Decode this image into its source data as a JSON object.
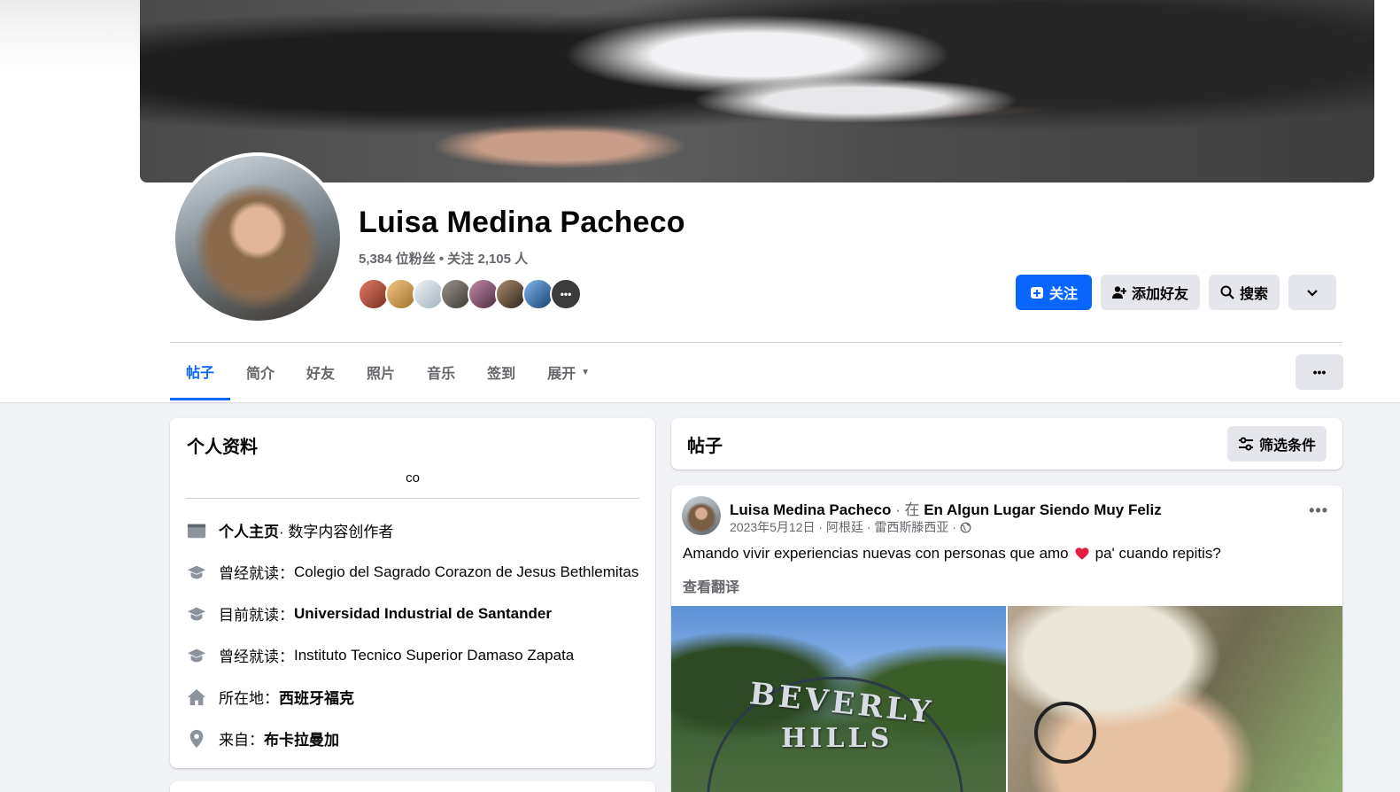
{
  "profile": {
    "name": "Luisa Medina Pacheco",
    "followers_text": "5,384 位粉丝 • 关注 2,105 人",
    "friend_avatar_colors": [
      "#b85a4c",
      "#d9a85c",
      "#c9d6de",
      "#6f6a64",
      "#8a5f78",
      "#5a4a3a",
      "#2f6fb8"
    ],
    "more_friends_label": "•••"
  },
  "actions": {
    "follow_label": "关注",
    "add_friend_label": "添加好友",
    "search_label": "搜索"
  },
  "tabs": [
    {
      "label": "帖子",
      "active": true
    },
    {
      "label": "简介"
    },
    {
      "label": "好友"
    },
    {
      "label": "照片"
    },
    {
      "label": "音乐"
    },
    {
      "label": "签到"
    },
    {
      "label": "展开"
    }
  ],
  "tabs_more_label": "•••",
  "intro": {
    "title": "个人资料",
    "bio": "co",
    "page_bold": "个人主页",
    "page_rest": " · 数字内容创作者",
    "edu1_label": "曾经就读：",
    "edu1_value": "Colegio del Sagrado Corazon de Jesus Bethlemitas",
    "edu2_label": "目前就读：",
    "edu2_value": "Universidad Industrial de Santander",
    "edu3_label": "曾经就读：",
    "edu3_value": "Instituto Tecnico Superior Damaso Zapata",
    "lives_label": "所在地：",
    "lives_value": "西班牙福克",
    "from_label": "来自：",
    "from_value": "布卡拉曼加"
  },
  "posts_section": {
    "title": "帖子",
    "filter_label": "筛选条件"
  },
  "post": {
    "author": "Luisa Medina Pacheco",
    "at_text": " · 在 ",
    "place": "En Algun Lugar Siendo Muy Feliz",
    "meta": "2023年5月12日 · 阿根廷 · 雷西斯滕西亚 ·",
    "text_before": "Amando vivir experiencias nuevas con personas que amo",
    "text_after": "pa' cuando repitis?",
    "see_translation": "查看翻译",
    "menu_label": "•••",
    "photo_text_1": "BEVERLY",
    "photo_text_2": "HILLS"
  },
  "colors": {
    "accent": "#0866ff",
    "heart": "#e41e3f"
  }
}
